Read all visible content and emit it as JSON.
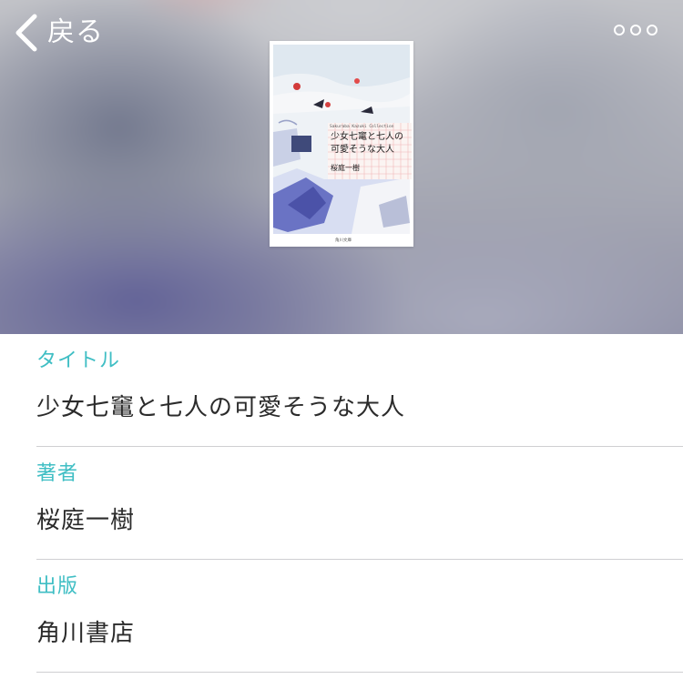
{
  "nav": {
    "back_label": "戻る",
    "back_icon": "chevron-left-icon",
    "more_icon": "more-dots-icon"
  },
  "cover": {
    "title_line1": "少女七竃と七人の",
    "title_line2": "可愛そうな大人",
    "series_text": "Sakuraba Kazuki Collection",
    "author": "桜庭一樹",
    "publisher_mark": "角川文庫"
  },
  "details": {
    "title_label": "タイトル",
    "title_value": "少女七竃と七人の可愛そうな大人",
    "author_label": "著者",
    "author_value": "桜庭一樹",
    "publisher_label": "出版",
    "publisher_value": "角川書店"
  },
  "colors": {
    "accent": "#3fbec4",
    "text": "#2b2b2b",
    "divider": "#cfcfd2"
  }
}
